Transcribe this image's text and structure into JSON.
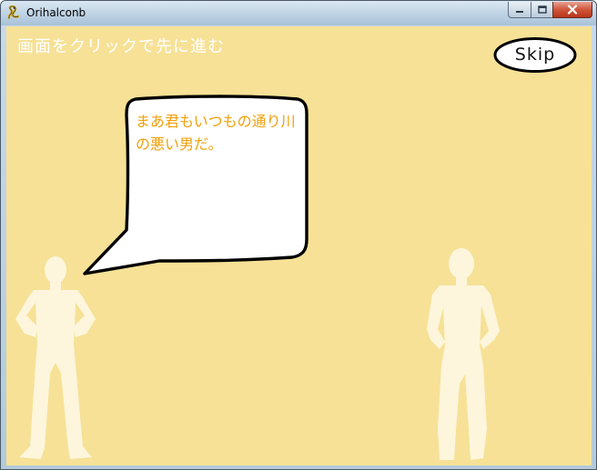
{
  "window": {
    "title": "Orihalconb",
    "app_icon": "pygame-snake-icon",
    "controls": [
      "minimize-icon",
      "maximize-icon",
      "close-icon"
    ]
  },
  "game": {
    "instruction": "画面をクリックで先に進む",
    "skip_label": "Skip",
    "dialogue": "まあ君もいつもの通り川の悪い男だ。",
    "colors": {
      "background": "#f6e196",
      "figures": "#fdf6dc",
      "dialogue_text": "#f0a00a",
      "instruction_text": "#ffffff"
    }
  }
}
